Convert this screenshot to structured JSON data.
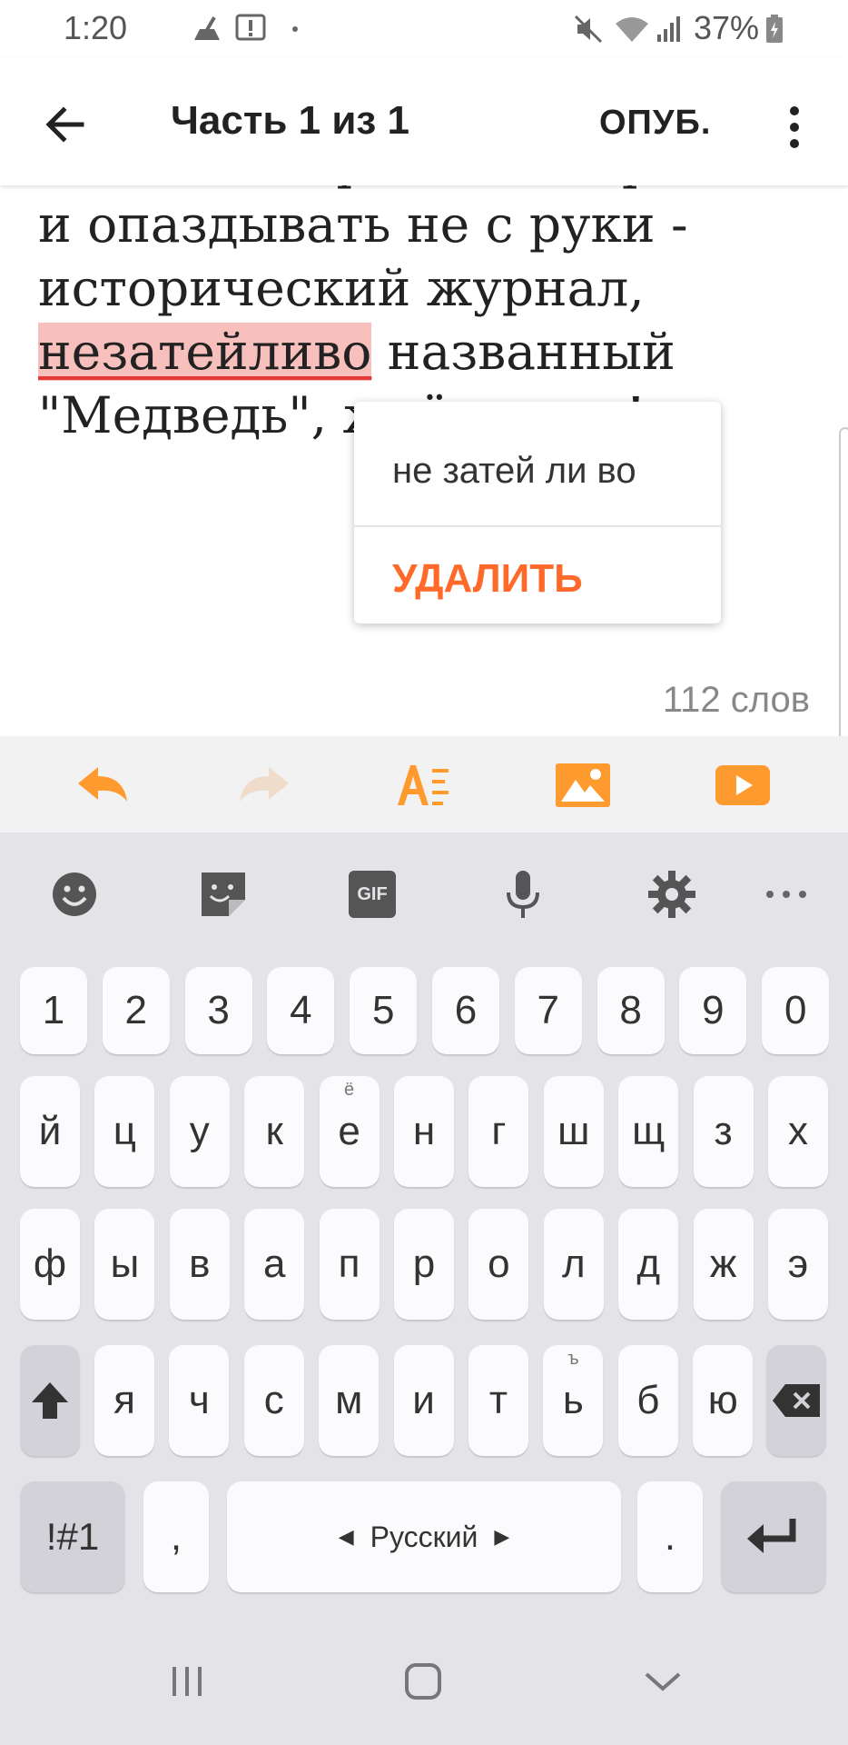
{
  "status_bar": {
    "time": "1:20",
    "battery": "37%"
  },
  "header": {
    "title": "Часть 1 из 1",
    "publish_label": "ОПУБ."
  },
  "editor": {
    "text_before": "Сегодня первый день работы и опаздывать не с руки - исторический журнал, ",
    "misspelled_word": "незатейливо",
    "text_after": " названный \"Медведь\", ждёт меня!",
    "word_count": "112 слов"
  },
  "suggestion_popup": {
    "suggestion": "не затей ли во",
    "delete_label": "УДАЛИТЬ"
  },
  "toolbar_icons": [
    "undo-icon",
    "redo-icon",
    "text-format-icon",
    "image-icon",
    "video-icon"
  ],
  "keyboard": {
    "top_icons": [
      "emoji-icon",
      "sticker-icon",
      "gif-icon",
      "mic-icon",
      "settings-icon",
      "more-icon"
    ],
    "gif_label": "GIF",
    "row_numbers": [
      "1",
      "2",
      "3",
      "4",
      "5",
      "6",
      "7",
      "8",
      "9",
      "0"
    ],
    "row1": [
      "й",
      "ц",
      "у",
      "к",
      "е",
      "н",
      "г",
      "ш",
      "щ",
      "з",
      "х"
    ],
    "row1_hint_e": "ё",
    "row2": [
      "ф",
      "ы",
      "в",
      "а",
      "п",
      "р",
      "о",
      "л",
      "д",
      "ж",
      "э"
    ],
    "row3": [
      "я",
      "ч",
      "с",
      "м",
      "и",
      "т",
      "ь",
      "б",
      "ю"
    ],
    "row3_hint_soft": "ъ",
    "symbols_label": "!#1",
    "comma": ",",
    "space_label": "Русский",
    "period": "."
  },
  "colors": {
    "accent": "#ff9a2e",
    "delete": "#ff6a2a",
    "misspelled_bg": "#f8c0bc"
  }
}
